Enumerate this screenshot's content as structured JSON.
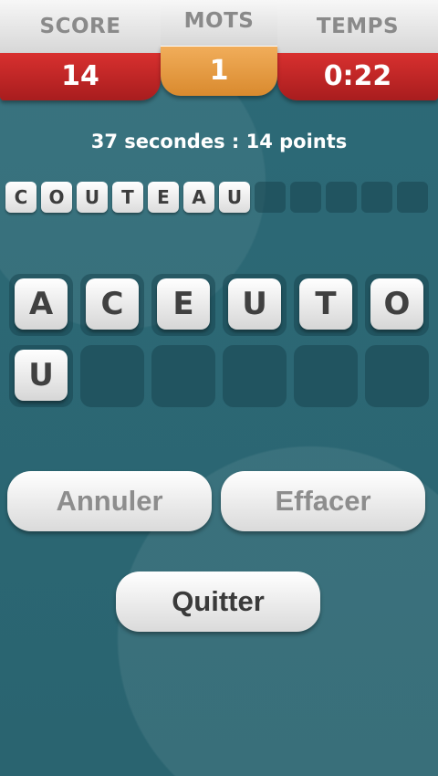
{
  "header": {
    "score_label": "SCORE",
    "score_value": "14",
    "words_label": "MOTS",
    "words_value": "1",
    "time_label": "TEMPS",
    "time_value": "0:22"
  },
  "status_text": "37 secondes : 14 points",
  "current_word": [
    "C",
    "O",
    "U",
    "T",
    "E",
    "A",
    "U",
    "",
    "",
    "",
    "",
    ""
  ],
  "letter_tiles": [
    "A",
    "C",
    "E",
    "U",
    "T",
    "O",
    "U",
    "",
    "",
    "",
    "",
    ""
  ],
  "buttons": {
    "cancel": "Annuler",
    "clear": "Effacer",
    "quit": "Quitter"
  }
}
